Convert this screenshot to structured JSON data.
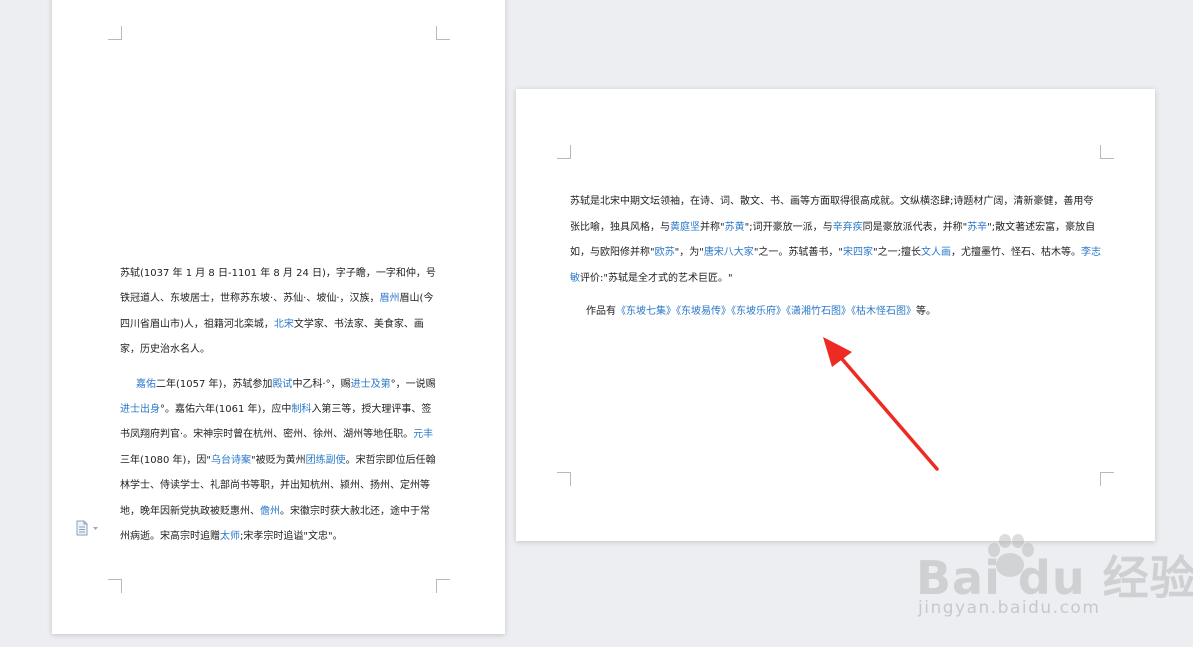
{
  "page1": {
    "para1": [
      {
        "t": "苏轼(1037 年 1 月 8 日-1101 年 8 月 24 日)，字子瞻，一字和仲，号铁冠道人、东坡居士，世称苏东坡·、苏仙·、坡仙·，汉族，"
      },
      {
        "l": "眉州"
      },
      {
        "t": "眉山(今四川省眉山市)人，祖籍河北栾城，"
      },
      {
        "l": "北宋"
      },
      {
        "t": "文学家、书法家、美食家、画家，历史治水名人。"
      }
    ],
    "para2": [
      {
        "l": "嘉佑"
      },
      {
        "t": "二年(1057 年)，苏轼参加"
      },
      {
        "l": "殿试"
      },
      {
        "t": "中乙科·°，赐"
      },
      {
        "l": "进士及第"
      },
      {
        "t": "°，一说赐"
      },
      {
        "l": "进士出身"
      },
      {
        "t": "°。嘉佑六年(1061 年)，应中"
      },
      {
        "l": "制科"
      },
      {
        "t": "入第三等，授大理评事、签书凤翔府判官·。宋神宗时曾在杭州、密州、徐州、湖州等地任职。"
      },
      {
        "l": "元丰"
      },
      {
        "t": "三年(1080 年)，因\""
      },
      {
        "l": "乌台诗案"
      },
      {
        "t": "\"被贬为黄州"
      },
      {
        "l": "团练副使"
      },
      {
        "t": "。宋哲宗即位后任翰林学士、侍读学士、礼部尚书等职，并出知杭州、颍州、扬州、定州等地，晚年因新党执政被贬惠州、"
      },
      {
        "l": "儋州"
      },
      {
        "t": "。宋徽宗时获大赦北还，途中于常州病逝。宋高宗时追赠"
      },
      {
        "l": "太师"
      },
      {
        "t": ";宋孝宗时追谥\"文忠\"。"
      }
    ]
  },
  "page2": {
    "para1": [
      {
        "t": "苏轼是北宋中期文坛领袖，在诗、词、散文、书、画等方面取得很高成就。文纵横恣肆;诗题材广阔，清新豪健，善用夸张比喻，独具风格，与"
      },
      {
        "l": "黄庭坚"
      },
      {
        "t": "并称\""
      },
      {
        "l": "苏黄"
      },
      {
        "t": "\";词开豪放一派，与"
      },
      {
        "l": "辛弃疾"
      },
      {
        "t": "同是豪放派代表，并称\""
      },
      {
        "l": "苏辛"
      },
      {
        "t": "\";散文著述宏富，豪放自如，与欧阳修并称\""
      },
      {
        "l": "欧苏"
      },
      {
        "t": "\"，为\""
      },
      {
        "l": "唐宋八大家"
      },
      {
        "t": "\"之一。苏轼善书，\""
      },
      {
        "l": "宋四家"
      },
      {
        "t": "\"之一;擅长"
      },
      {
        "l": "文人画"
      },
      {
        "t": "，尤擅墨竹、怪石、枯木等。"
      },
      {
        "l": "李志敏"
      },
      {
        "t": "评价:\"苏轼是全才式的艺术巨匠。\""
      }
    ],
    "para2": [
      {
        "t": "作品有"
      },
      {
        "l": "《东坡七集》"
      },
      {
        "l": "《东坡易传》"
      },
      {
        "l": "《东坡乐府》"
      },
      {
        "l": "《潇湘竹石图》"
      },
      {
        "l": "《枯木怪石图》"
      },
      {
        "t": "等。"
      }
    ]
  },
  "watermark": {
    "brand": "Bai du 经验",
    "url": "jingyan.baidu.com"
  },
  "colors": {
    "link": "#2b79c9",
    "arrow": "#ee2a24",
    "background": "#eceef1"
  },
  "icons": [
    "paragraph-options-icon",
    "red-annotation-arrow",
    "baidu-paw-icon"
  ]
}
